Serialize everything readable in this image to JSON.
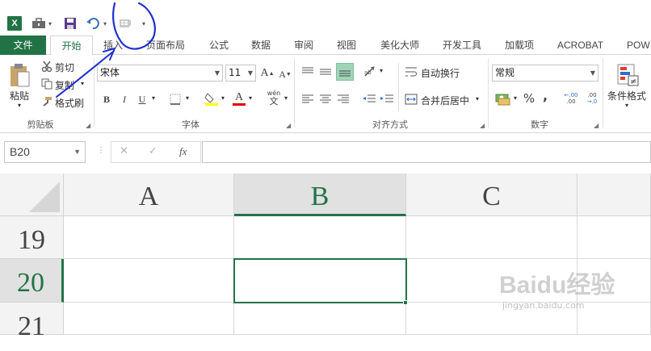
{
  "app": {
    "logo": "X"
  },
  "qat": {
    "icons": [
      "excel-logo",
      "briefcase-icon",
      "save-icon",
      "undo-icon",
      "form-icon",
      "customize-qat-icon"
    ],
    "dropdown": "▾"
  },
  "tabs": [
    "文件",
    "开始",
    "插入",
    "页面布局",
    "公式",
    "数据",
    "审阅",
    "视图",
    "美化大师",
    "开发工具",
    "加载项",
    "ACROBAT",
    "POW"
  ],
  "clipboard": {
    "paste": "粘贴",
    "cut": "剪切",
    "copy": "复制",
    "format_painter": "格式刷",
    "group_label": "剪贴板"
  },
  "font": {
    "name": "宋体",
    "size": "11",
    "bold": "B",
    "italic": "I",
    "underline": "U",
    "grow": "A",
    "shrink": "A",
    "phonetic": "wén",
    "font_color_letter": "A",
    "group_label": "字体"
  },
  "alignment": {
    "wrap_text": "自动换行",
    "merge_center": "合并后居中",
    "group_label": "对齐方式"
  },
  "number": {
    "format": "常规",
    "percent": "%",
    "comma": ",",
    "inc_decimal": ".00",
    "dec_decimal": ".00",
    "group_label": "数字"
  },
  "styles": {
    "conditional_format": "条件格式"
  },
  "formula_bar": {
    "name_box": "B20",
    "cancel": "✕",
    "enter": "✓",
    "fx": "fx",
    "value": ""
  },
  "sheet": {
    "columns": [
      "A",
      "B",
      "C"
    ],
    "rows": [
      "19",
      "20",
      "21"
    ],
    "active_cell": "B20"
  },
  "watermark": {
    "logo": "Baidu经验",
    "url": "jingyan.baidu.com"
  },
  "colors": {
    "accent": "#217346",
    "annotation": "#1f2fd1"
  }
}
